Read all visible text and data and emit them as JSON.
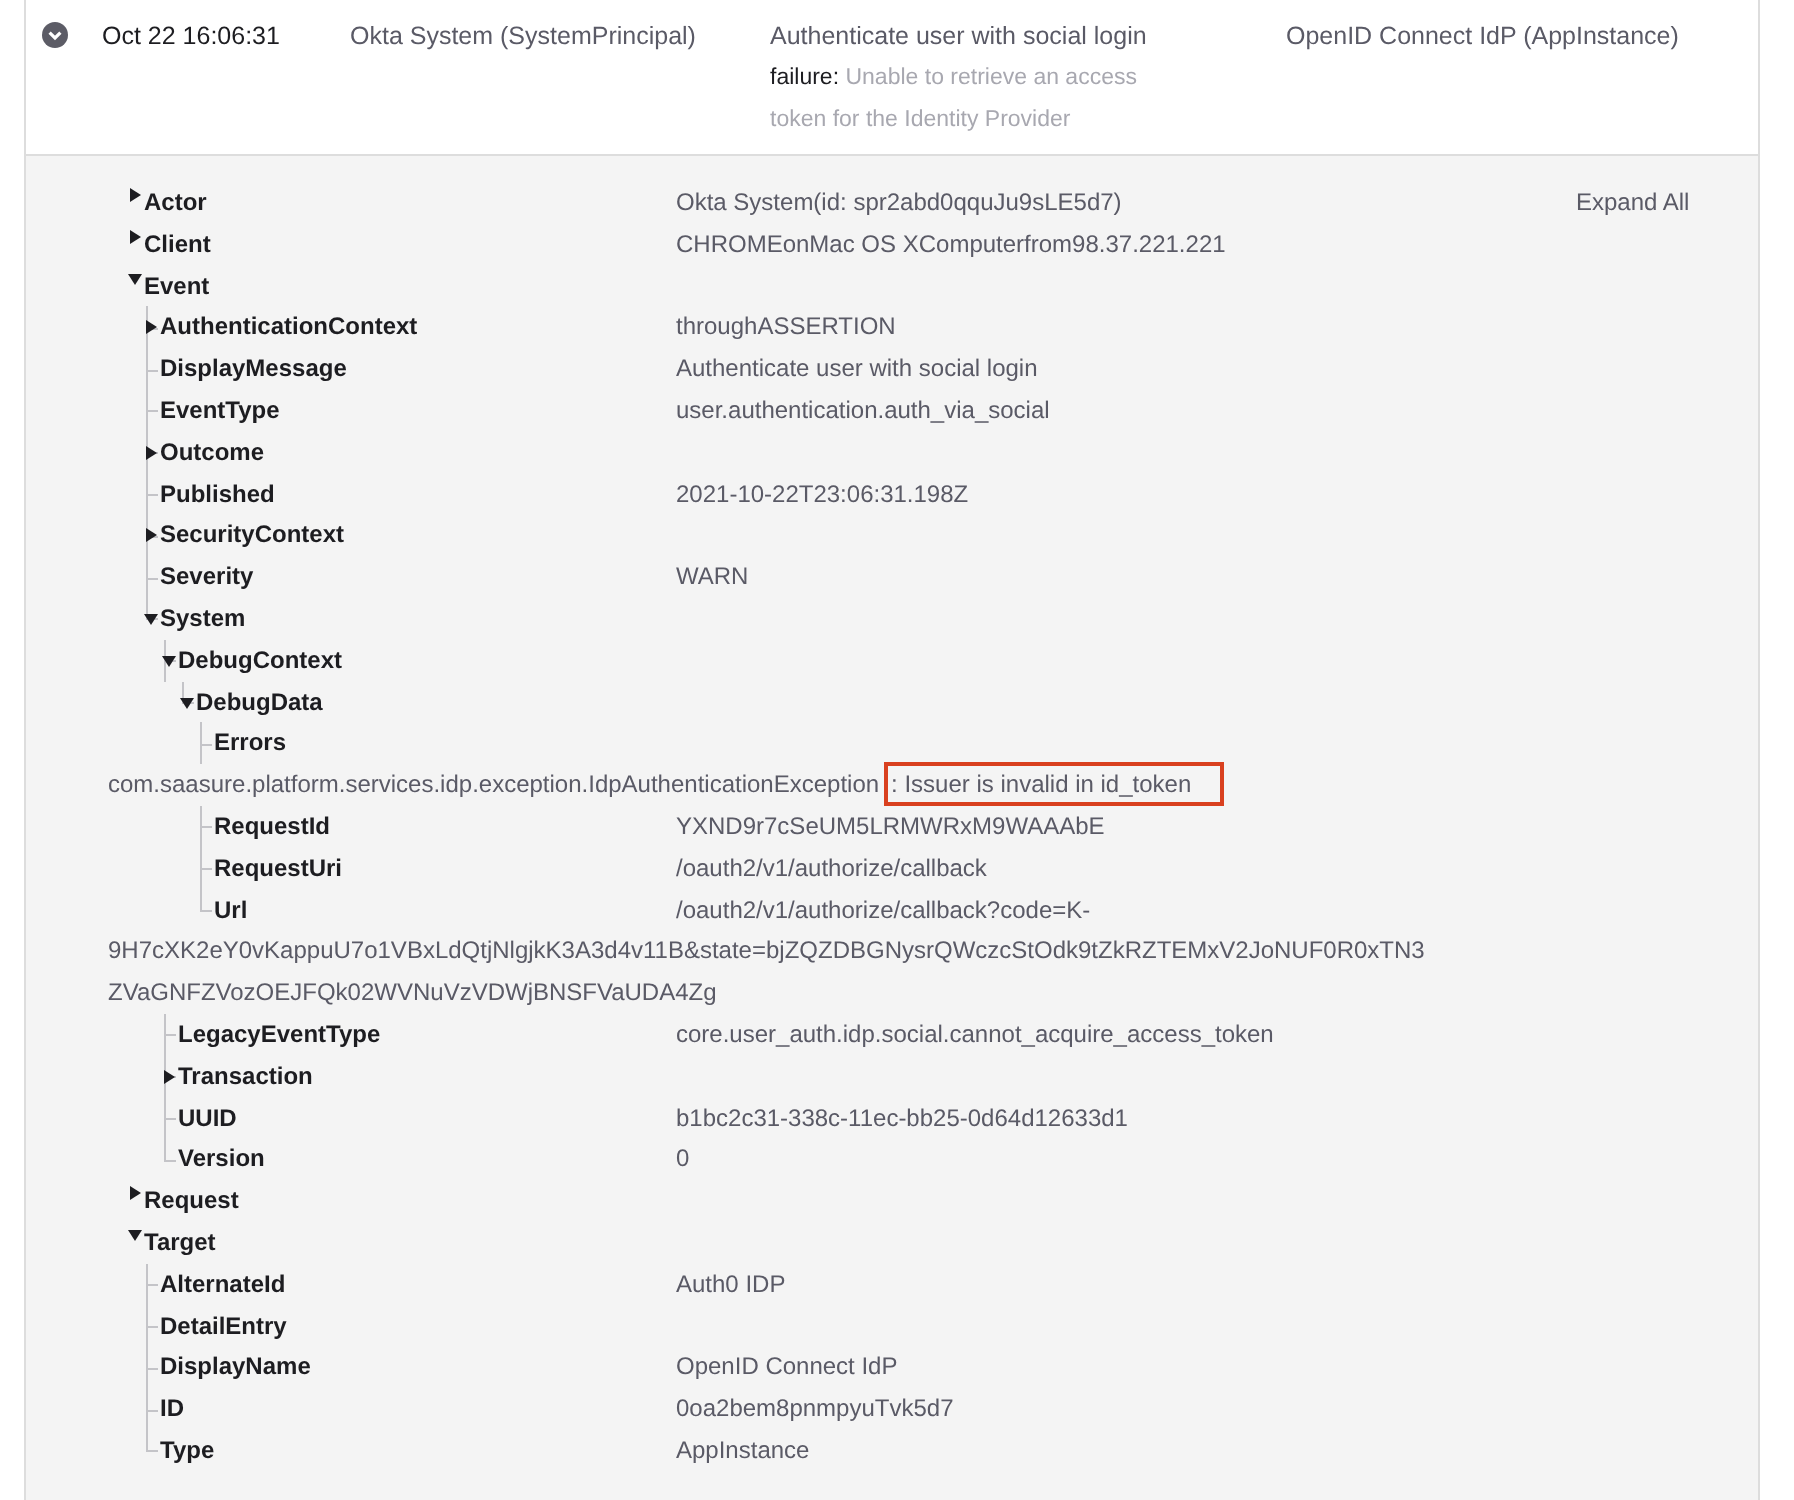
{
  "event_row": {
    "expanded": true,
    "time": "Oct 22 16:06:31",
    "actor": "Okta System (SystemPrincipal)",
    "event": "Authenticate user with social login",
    "outcome": "failure:",
    "outcome_reason": "Unable to retrieve an access token for the Identity Provider",
    "target": "OpenID Connect IdP  (AppInstance)"
  },
  "panel": {
    "expand_all": "Expand All",
    "tree": [
      {
        "label": "Actor",
        "expanded": false,
        "value": "Okta System(id: spr2abd0qquJu9sLE5d7)"
      },
      {
        "label": "Client",
        "expanded": false,
        "value": "CHROMEonMac OS XComputerfrom98.37.221.221"
      },
      {
        "label": "Event",
        "expanded": true,
        "children": [
          {
            "label": "AuthenticationContext",
            "expanded": false,
            "value": "throughASSERTION"
          },
          {
            "label": "DisplayMessage",
            "value": "Authenticate user with social login"
          },
          {
            "label": "EventType",
            "value": "user.authentication.auth_via_social"
          },
          {
            "label": "Outcome",
            "expanded": false
          },
          {
            "label": "Published",
            "value": "2021-10-22T23:06:31.198Z"
          },
          {
            "label": "SecurityContext",
            "expanded": false
          },
          {
            "label": "Severity",
            "value": "WARN"
          },
          {
            "label": "System",
            "expanded": true,
            "children": [
              {
                "label": "DebugContext",
                "expanded": true,
                "children": [
                  {
                    "label": "DebugData",
                    "expanded": true,
                    "children": [
                      {
                        "label": "Errors",
                        "value": "com.saasure.platform.services.idp.exception.IdpAuthenticationException",
                        "highlighted": ": Issuer is invalid in id_token"
                      },
                      {
                        "label": "RequestId",
                        "value": "YXND9r7cSeUM5LRMWRxM9WAAAbE"
                      },
                      {
                        "label": "RequestUri",
                        "value": "/oauth2/v1/authorize/callback"
                      },
                      {
                        "label": "Url",
                        "value": "/oauth2/v1/authorize/callback?code=K-9H7cXK2eY0vKappuU7o1VBxLdQtjNlgjkK3A3d4v11B&state=bjZQZDBGNysrQWczcStOdk9tZkRZTEMxV2JoNUF0R0xTN3ZVaGNFZVozOEJFQk02WVNuVzVDWjBNSFVaUDA4Zg"
                      }
                    ]
                  }
                ]
              },
              {
                "label": "LegacyEventType",
                "value": "core.user_auth.idp.social.cannot_acquire_access_token"
              },
              {
                "label": "Transaction",
                "expanded": false
              },
              {
                "label": "UUID",
                "value": "b1bc2c31-338c-11ec-bb25-0d64d12633d1"
              },
              {
                "label": "Version",
                "value": "0"
              }
            ]
          }
        ]
      },
      {
        "label": "Request",
        "expanded": false
      },
      {
        "label": "Target",
        "expanded": true,
        "children": [
          {
            "label": "AlternateId",
            "value": "Auth0 IDP"
          },
          {
            "label": "DetailEntry"
          },
          {
            "label": "DisplayName",
            "value": "OpenID Connect IdP"
          },
          {
            "label": "ID",
            "value": "0oa2bem8pnmpyuTvk5d7"
          },
          {
            "label": "Type",
            "value": "AppInstance"
          }
        ]
      }
    ]
  }
}
